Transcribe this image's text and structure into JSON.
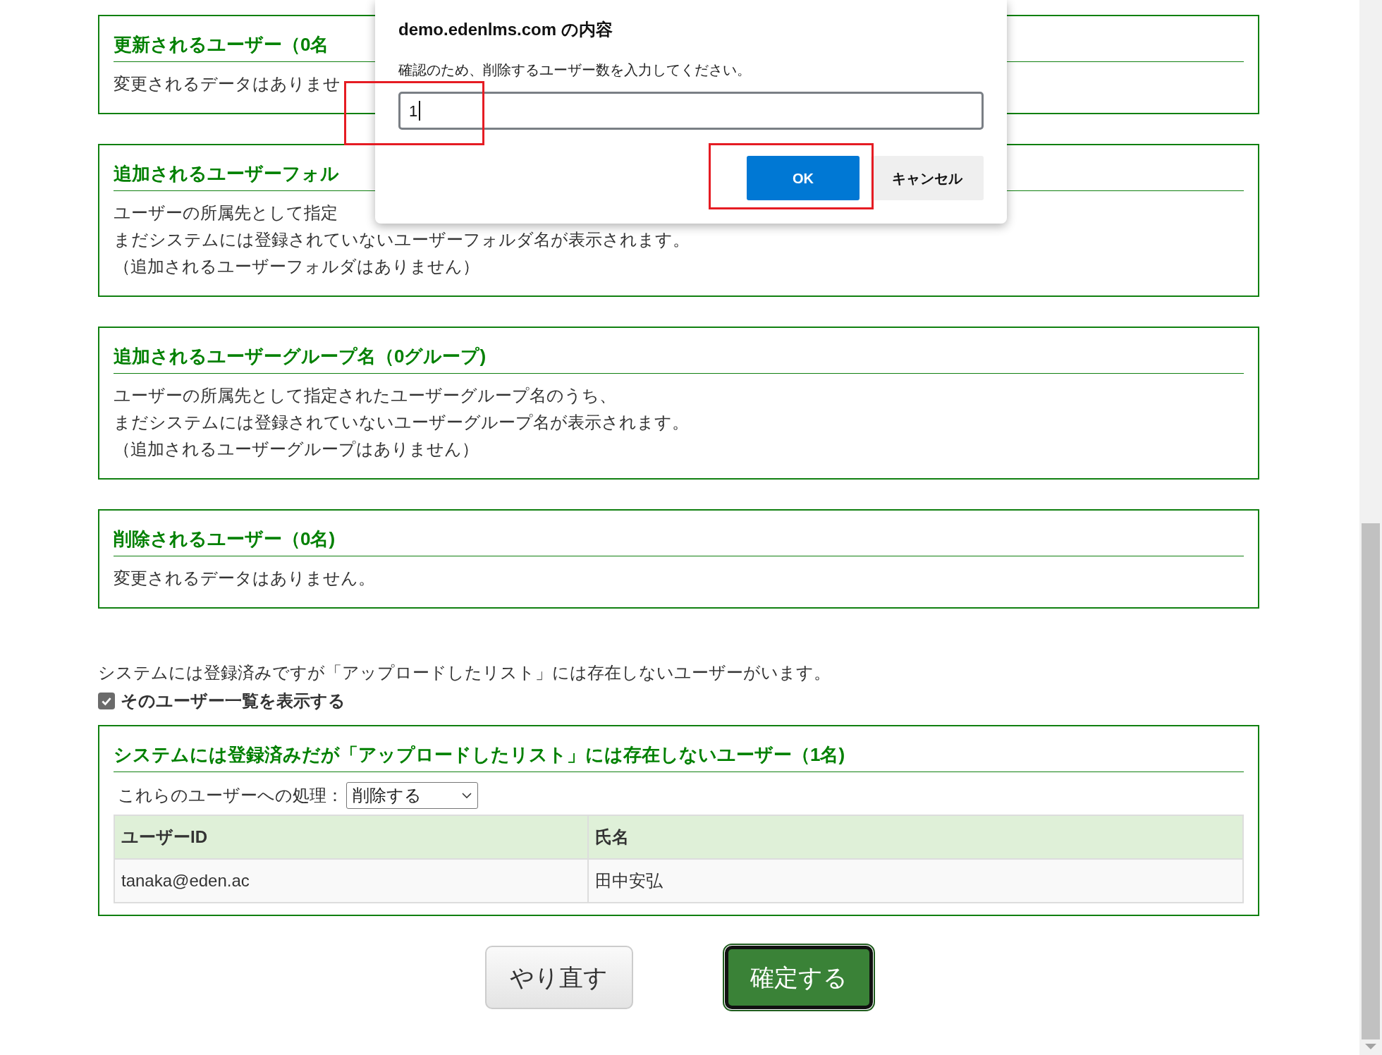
{
  "dialog": {
    "title": "demo.edenlms.com の内容",
    "message": "確認のため、削除するユーザー数を入力してください。",
    "input_value": "1",
    "buttons": [
      {
        "label": "OK",
        "kind": "primary"
      },
      {
        "label": "キャンセル",
        "kind": "secondary"
      }
    ]
  },
  "sections": [
    {
      "title": "更新されるユーザー（0名",
      "lines": [
        "変更されるデータはありませ"
      ]
    },
    {
      "title": "追加されるユーザーフォル",
      "lines": [
        "ユーザーの所属先として指定",
        "まだシステムには登録されていないユーザーフォルダ名が表示されます。",
        "（追加されるユーザーフォルダはありません）"
      ]
    },
    {
      "title": "追加されるユーザーグループ名（0グループ)",
      "lines": [
        "ユーザーの所属先として指定されたユーザーグループ名のうち、",
        "まだシステムには登録されていないユーザーグループ名が表示されます。",
        "（追加されるユーザーグループはありません）"
      ]
    },
    {
      "title": "削除されるユーザー（0名)",
      "lines": [
        "変更されるデータはありません。"
      ]
    }
  ],
  "notice": "システムには登録済みですが「アップロードしたリスト」には存在しないユーザーがいます。",
  "show_list": {
    "label": "そのユーザー一覧を表示する",
    "checked": true
  },
  "missing_users": {
    "title": "システムには登録済みだが「アップロードしたリスト」には存在しないユーザー（1名)",
    "action_label": "これらのユーザーへの処理：",
    "action_value": "削除する",
    "columns": [
      "ユーザーID",
      "氏名"
    ],
    "rows": [
      [
        "tanaka@eden.ac",
        "田中安弘"
      ]
    ]
  },
  "buttons": [
    {
      "label": "やり直す",
      "kind": "reset"
    },
    {
      "label": "確定する",
      "kind": "confirm"
    }
  ]
}
